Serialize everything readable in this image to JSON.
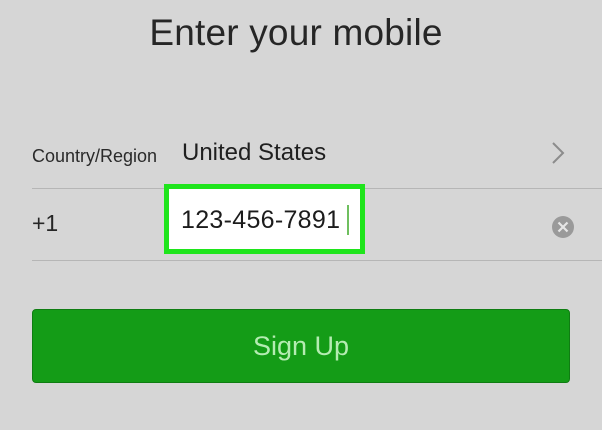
{
  "header": {
    "title": "Enter your mobile"
  },
  "country_row": {
    "label": "Country/Region",
    "value": "United States",
    "icon": "chevron-right-icon"
  },
  "phone_row": {
    "prefix": "+1",
    "number": "123-456-7891",
    "clear_icon": "clear-icon"
  },
  "actions": {
    "signup_label": "Sign Up"
  },
  "colors": {
    "background": "#d6d6d6",
    "button": "#149c17",
    "button_text": "#b4ecb2",
    "highlight": "#1fe51c"
  }
}
